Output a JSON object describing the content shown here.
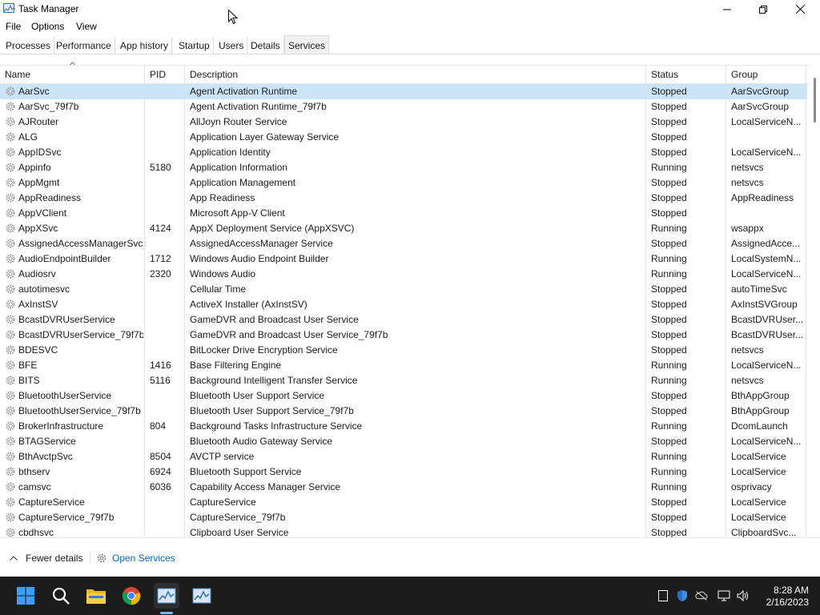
{
  "window": {
    "title": "Task Manager"
  },
  "menu": [
    "File",
    "Options",
    "View"
  ],
  "tabs": [
    "Processes",
    "Performance",
    "App history",
    "Startup",
    "Users",
    "Details",
    "Services"
  ],
  "active_tab": "Services",
  "columns": [
    "Name",
    "PID",
    "Description",
    "Status",
    "Group"
  ],
  "services": [
    {
      "name": "AarSvc",
      "pid": "",
      "desc": "Agent Activation Runtime",
      "status": "Stopped",
      "group": "AarSvcGroup"
    },
    {
      "name": "AarSvc_79f7b",
      "pid": "",
      "desc": "Agent Activation Runtime_79f7b",
      "status": "Stopped",
      "group": "AarSvcGroup"
    },
    {
      "name": "AJRouter",
      "pid": "",
      "desc": "AllJoyn Router Service",
      "status": "Stopped",
      "group": "LocalServiceN..."
    },
    {
      "name": "ALG",
      "pid": "",
      "desc": "Application Layer Gateway Service",
      "status": "Stopped",
      "group": ""
    },
    {
      "name": "AppIDSvc",
      "pid": "",
      "desc": "Application Identity",
      "status": "Stopped",
      "group": "LocalServiceN..."
    },
    {
      "name": "Appinfo",
      "pid": "5180",
      "desc": "Application Information",
      "status": "Running",
      "group": "netsvcs"
    },
    {
      "name": "AppMgmt",
      "pid": "",
      "desc": "Application Management",
      "status": "Stopped",
      "group": "netsvcs"
    },
    {
      "name": "AppReadiness",
      "pid": "",
      "desc": "App Readiness",
      "status": "Stopped",
      "group": "AppReadiness"
    },
    {
      "name": "AppVClient",
      "pid": "",
      "desc": "Microsoft App-V Client",
      "status": "Stopped",
      "group": ""
    },
    {
      "name": "AppXSvc",
      "pid": "4124",
      "desc": "AppX Deployment Service (AppXSVC)",
      "status": "Running",
      "group": "wsappx"
    },
    {
      "name": "AssignedAccessManagerSvc",
      "pid": "",
      "desc": "AssignedAccessManager Service",
      "status": "Stopped",
      "group": "AssignedAcce..."
    },
    {
      "name": "AudioEndpointBuilder",
      "pid": "1712",
      "desc": "Windows Audio Endpoint Builder",
      "status": "Running",
      "group": "LocalSystemN..."
    },
    {
      "name": "Audiosrv",
      "pid": "2320",
      "desc": "Windows Audio",
      "status": "Running",
      "group": "LocalServiceN..."
    },
    {
      "name": "autotimesvc",
      "pid": "",
      "desc": "Cellular Time",
      "status": "Stopped",
      "group": "autoTimeSvc"
    },
    {
      "name": "AxInstSV",
      "pid": "",
      "desc": "ActiveX Installer (AxInstSV)",
      "status": "Stopped",
      "group": "AxInstSVGroup"
    },
    {
      "name": "BcastDVRUserService",
      "pid": "",
      "desc": "GameDVR and Broadcast User Service",
      "status": "Stopped",
      "group": "BcastDVRUser..."
    },
    {
      "name": "BcastDVRUserService_79f7b",
      "pid": "",
      "desc": "GameDVR and Broadcast User Service_79f7b",
      "status": "Stopped",
      "group": "BcastDVRUser..."
    },
    {
      "name": "BDESVC",
      "pid": "",
      "desc": "BitLocker Drive Encryption Service",
      "status": "Stopped",
      "group": "netsvcs"
    },
    {
      "name": "BFE",
      "pid": "1416",
      "desc": "Base Filtering Engine",
      "status": "Running",
      "group": "LocalServiceN..."
    },
    {
      "name": "BITS",
      "pid": "5116",
      "desc": "Background Intelligent Transfer Service",
      "status": "Running",
      "group": "netsvcs"
    },
    {
      "name": "BluetoothUserService",
      "pid": "",
      "desc": "Bluetooth User Support Service",
      "status": "Stopped",
      "group": "BthAppGroup"
    },
    {
      "name": "BluetoothUserService_79f7b",
      "pid": "",
      "desc": "Bluetooth User Support Service_79f7b",
      "status": "Stopped",
      "group": "BthAppGroup"
    },
    {
      "name": "BrokerInfrastructure",
      "pid": "804",
      "desc": "Background Tasks Infrastructure Service",
      "status": "Running",
      "group": "DcomLaunch"
    },
    {
      "name": "BTAGService",
      "pid": "",
      "desc": "Bluetooth Audio Gateway Service",
      "status": "Stopped",
      "group": "LocalServiceN..."
    },
    {
      "name": "BthAvctpSvc",
      "pid": "8504",
      "desc": "AVCTP service",
      "status": "Running",
      "group": "LocalService"
    },
    {
      "name": "bthserv",
      "pid": "6924",
      "desc": "Bluetooth Support Service",
      "status": "Running",
      "group": "LocalService"
    },
    {
      "name": "camsvc",
      "pid": "6036",
      "desc": "Capability Access Manager Service",
      "status": "Running",
      "group": "osprivacy"
    },
    {
      "name": "CaptureService",
      "pid": "",
      "desc": "CaptureService",
      "status": "Stopped",
      "group": "LocalService"
    },
    {
      "name": "CaptureService_79f7b",
      "pid": "",
      "desc": "CaptureService_79f7b",
      "status": "Stopped",
      "group": "LocalService"
    },
    {
      "name": "cbdhsvc",
      "pid": "",
      "desc": "Clipboard User Service",
      "status": "Stopped",
      "group": "ClipboardSvc..."
    }
  ],
  "selected_row": 0,
  "footer": {
    "fewer_details": "Fewer details",
    "open_services": "Open Services"
  },
  "taskbar": {
    "icons": [
      "start-icon",
      "search-icon",
      "file-explorer-icon",
      "chrome-icon",
      "task-manager-icon",
      "task-manager-icon"
    ],
    "time": "8:28 AM",
    "date": "2/16/2023"
  },
  "colors": {
    "selection": "#cce4f7",
    "link": "#0066cc",
    "taskbar": "#1c1c1c"
  }
}
